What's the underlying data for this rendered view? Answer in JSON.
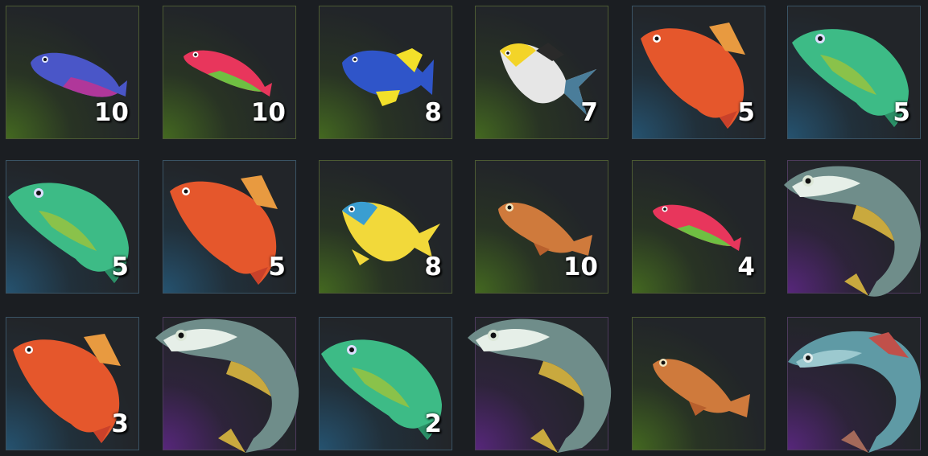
{
  "inventory": {
    "slots": [
      {
        "fish": "blue-purple-wrasse",
        "rarity": "green",
        "qty": "10"
      },
      {
        "fish": "pink-wrasse",
        "rarity": "green",
        "qty": "10"
      },
      {
        "fish": "blue-yellow-tang",
        "rarity": "green",
        "qty": "8"
      },
      {
        "fish": "yellow-white-angelfish",
        "rarity": "green",
        "qty": "7"
      },
      {
        "fish": "red-snapper",
        "rarity": "blue",
        "qty": "5"
      },
      {
        "fish": "green-bass",
        "rarity": "blue",
        "qty": "5"
      },
      {
        "fish": "green-bass",
        "rarity": "blue",
        "qty": "5"
      },
      {
        "fish": "red-snapper",
        "rarity": "blue",
        "qty": "5"
      },
      {
        "fish": "blue-yellow-angelfish",
        "rarity": "green",
        "qty": "8"
      },
      {
        "fish": "orange-goby",
        "rarity": "green",
        "qty": "10"
      },
      {
        "fish": "pink-wrasse",
        "rarity": "green",
        "qty": "4"
      },
      {
        "fish": "leaping-tuna",
        "rarity": "purple",
        "qty": ""
      },
      {
        "fish": "red-snapper",
        "rarity": "blue",
        "qty": "3"
      },
      {
        "fish": "leaping-tuna",
        "rarity": "purple",
        "qty": ""
      },
      {
        "fish": "green-bass",
        "rarity": "blue",
        "qty": "2"
      },
      {
        "fish": "leaping-tuna",
        "rarity": "purple",
        "qty": ""
      },
      {
        "fish": "orange-goby",
        "rarity": "green",
        "qty": ""
      },
      {
        "fish": "leaping-mackerel",
        "rarity": "purple",
        "qty": ""
      }
    ]
  }
}
